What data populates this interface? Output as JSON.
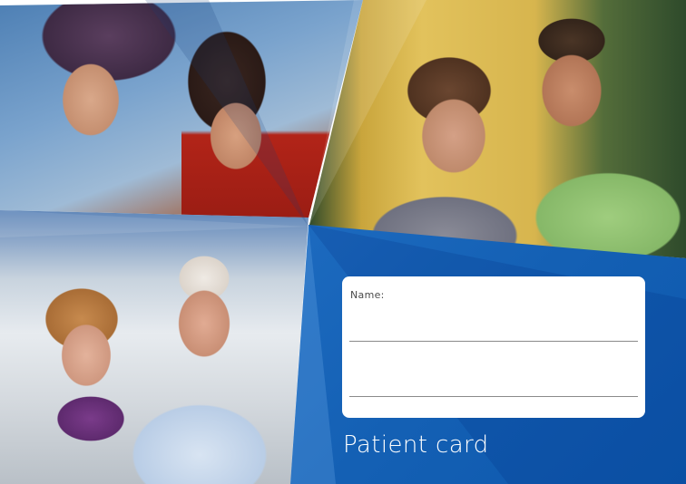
{
  "card": {
    "name_label": "Name:",
    "title": "Patient card"
  },
  "photos": [
    {
      "id": "photo-two-women"
    },
    {
      "id": "photo-young-couple"
    },
    {
      "id": "photo-older-couple"
    }
  ],
  "colors": {
    "brand_blue": "#1e6cc1",
    "box_background": "#ffffff",
    "title_text": "#ffffff"
  }
}
